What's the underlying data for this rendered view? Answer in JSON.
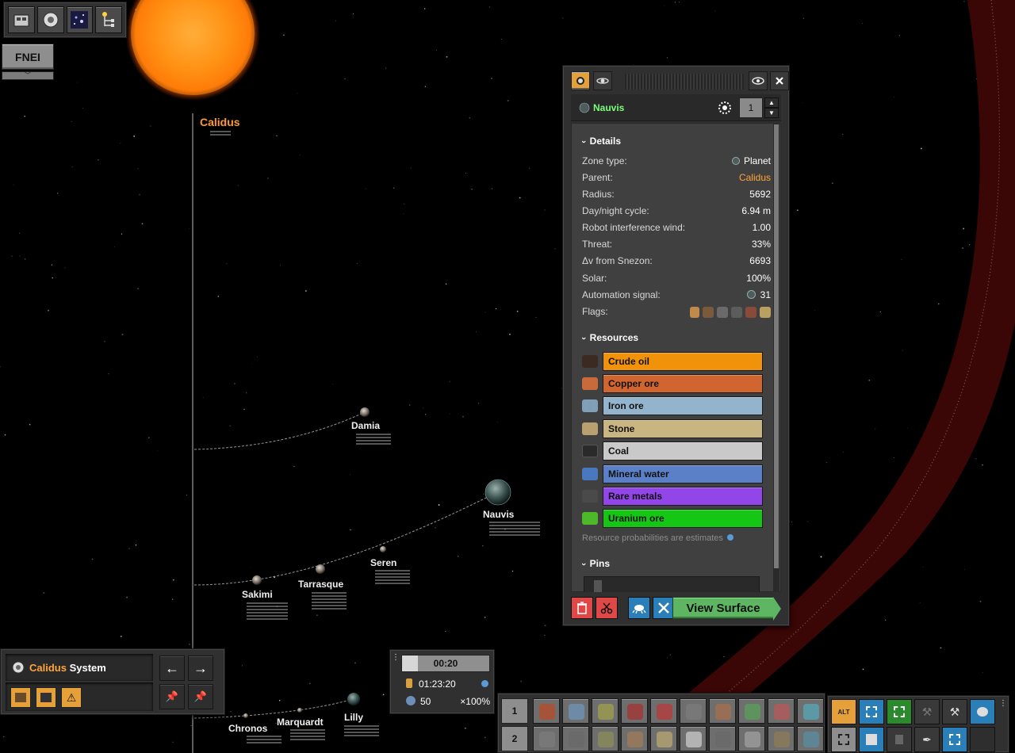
{
  "starmap": {
    "star": {
      "name": "Calidus"
    },
    "bodies": [
      {
        "id": "damia",
        "name": "Damia"
      },
      {
        "id": "nauvis",
        "name": "Nauvis"
      },
      {
        "id": "seren",
        "name": "Seren"
      },
      {
        "id": "tarrasque",
        "name": "Tarrasque"
      },
      {
        "id": "sakimi",
        "name": "Sakimi"
      },
      {
        "id": "chronos",
        "name": "Chronos"
      },
      {
        "id": "marquardt",
        "name": "Marquardt"
      },
      {
        "id": "lilly",
        "name": "Lilly"
      }
    ]
  },
  "topbar": {
    "fnei_label": "FNEI"
  },
  "zone_panel": {
    "zone_name": "Nauvis",
    "priority": "1",
    "details_title": "Details",
    "details": [
      {
        "key": "Zone type:",
        "value": "Planet"
      },
      {
        "key": "Parent:",
        "value": "Calidus"
      },
      {
        "key": "Radius:",
        "value": "5692"
      },
      {
        "key": "Day/night cycle:",
        "value": "6.94 m"
      },
      {
        "key": "Robot interference wind:",
        "value": "1.00"
      },
      {
        "key": "Threat:",
        "value": "33%"
      },
      {
        "key": "Δv from Snezon:",
        "value": "6693"
      },
      {
        "key": "Solar:",
        "value": "100%"
      },
      {
        "key": "Automation signal:",
        "value": "31"
      },
      {
        "key": "Flags:",
        "value": ""
      }
    ],
    "resources_title": "Resources",
    "resources": [
      {
        "name": "Crude oil",
        "color": "#f0930a"
      },
      {
        "name": "Copper ore",
        "color": "#d0652f"
      },
      {
        "name": "Iron ore",
        "color": "#93b4cc"
      },
      {
        "name": "Stone",
        "color": "#c8b581"
      },
      {
        "name": "Coal",
        "color": "#c9c9c9"
      },
      {
        "name": "Mineral water",
        "color": "#5b80c8"
      },
      {
        "name": "Rare metals",
        "color": "#9246e8"
      },
      {
        "name": "Uranium ore",
        "color": "#15c615"
      }
    ],
    "resources_note": "Resource probabilities are estimates",
    "pins_title": "Pins",
    "view_surface_label": "View Surface"
  },
  "system_panel": {
    "system_name_highlight": "Calidus",
    "system_name_suffix": " System"
  },
  "clock": {
    "time": "00:20",
    "progress": 0.18,
    "elapsed": "01:23:20",
    "speed_value": "50",
    "speed_multiplier": "×100%"
  },
  "quickbar": {
    "row1_label": "1",
    "row2_label": "2"
  },
  "shortcuts": {
    "alt_label": "ALT"
  },
  "colors": {
    "accent_orange": "#ffa53a",
    "zone_green": "#7bff7b",
    "button_red": "#e04848",
    "button_blue": "#2a7fb8",
    "button_green": "#5eb663"
  }
}
